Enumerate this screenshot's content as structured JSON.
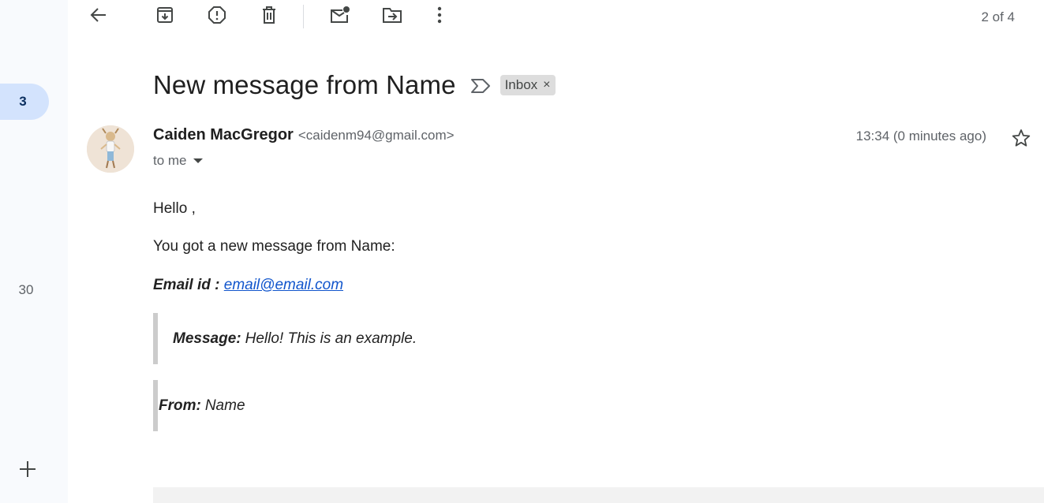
{
  "rail": {
    "badge_count": "3",
    "secondary_count": "30",
    "add_icon": "plus-icon"
  },
  "toolbar": {
    "buttons": [
      {
        "name": "back",
        "icon": "arrow-left-icon"
      },
      {
        "name": "archive",
        "icon": "archive-icon"
      },
      {
        "name": "report-spam",
        "icon": "report-icon"
      },
      {
        "name": "delete",
        "icon": "trash-icon"
      },
      {
        "name": "mark-unread",
        "icon": "mark-unread-icon"
      },
      {
        "name": "move-to",
        "icon": "move-to-icon"
      },
      {
        "name": "more",
        "icon": "more-vert-icon"
      }
    ],
    "pager": "2 of 4"
  },
  "message": {
    "subject": "New message from Name",
    "label": "Inbox",
    "label_remove": "×",
    "sender_name": "Caiden MacGregor",
    "sender_email": "<caidenm94@gmail.com>",
    "recipient": "to me",
    "timestamp": "13:34 (0 minutes ago)"
  },
  "body": {
    "greeting": "Hello ,",
    "intro": "You got a new message from Name:",
    "email_label": "Email id :",
    "email_value": "email@email.com",
    "message_label": "Message:",
    "message_value": "Hello! This is an example.",
    "from_label": "From:",
    "from_value": "Name"
  },
  "colors": {
    "rail_bg": "#f8fafd",
    "badge_bg": "#d3e3fd",
    "link": "#1155cc",
    "label_chip_bg": "#dddddd",
    "quote_border": "#cccccc"
  }
}
